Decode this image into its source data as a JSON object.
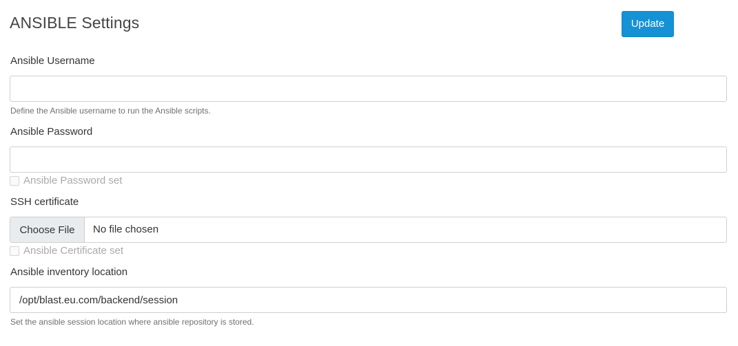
{
  "header": {
    "title": "ANSIBLE Settings",
    "update_label": "Update"
  },
  "colors": {
    "accent": "#1592d6",
    "text": "#333333",
    "muted": "#707070"
  },
  "form": {
    "username": {
      "label": "Ansible Username",
      "value": "",
      "help": "Define the Ansible username to run the Ansible scripts."
    },
    "password": {
      "label": "Ansible Password",
      "value": "",
      "checkbox_label": "Ansible Password set",
      "checked": false
    },
    "certificate": {
      "label": "SSH certificate",
      "button_label": "Choose File",
      "file_status": "No file chosen",
      "checkbox_label": "Ansible Certificate set",
      "checked": false
    },
    "inventory": {
      "label": "Ansible inventory location",
      "value": "/opt/blast.eu.com/backend/session",
      "help": "Set the ansible session location where ansible repository is stored."
    }
  }
}
